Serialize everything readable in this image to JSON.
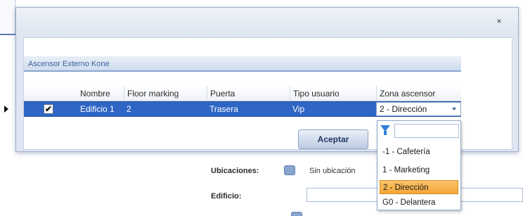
{
  "dialog": {
    "close_glyph": "×"
  },
  "group": {
    "title": "Ascensor Externo Kone"
  },
  "grid": {
    "columns": [
      "Nombre",
      "Floor marking",
      "Puerta",
      "Tipo usuario",
      "Zona ascensor"
    ],
    "row": {
      "checked_glyph": "✔",
      "nombre": "Edificio 1",
      "floor_marking": "2",
      "puerta": "Trasera",
      "tipo_usuario": "Vip",
      "zona_ascensor": "2 - Dirección"
    }
  },
  "accept_label": "Aceptar",
  "dropdown": {
    "filter_value": "",
    "options": [
      "-1 - Cafetería",
      "1 - Marketing",
      "2 - Dirección",
      "G0 - Delantera"
    ],
    "selected_index": 2
  },
  "background_form": {
    "ubicaciones_label": "Ubicaciones:",
    "ubicaciones_value": "Sin ubicación",
    "edificio_label": "Edificio:"
  },
  "colors": {
    "selected_row": "#2f66c5",
    "selected_option": "#f5a637",
    "group_header_text": "#3a5f99"
  },
  "icons": {
    "close": "close-icon",
    "row_indicator": "row-pointer-icon",
    "checkbox": "checkbox-checked-icon",
    "dropdown": "chevron-down-icon",
    "filter": "filter-icon",
    "ubicaciones": "location-icon"
  }
}
